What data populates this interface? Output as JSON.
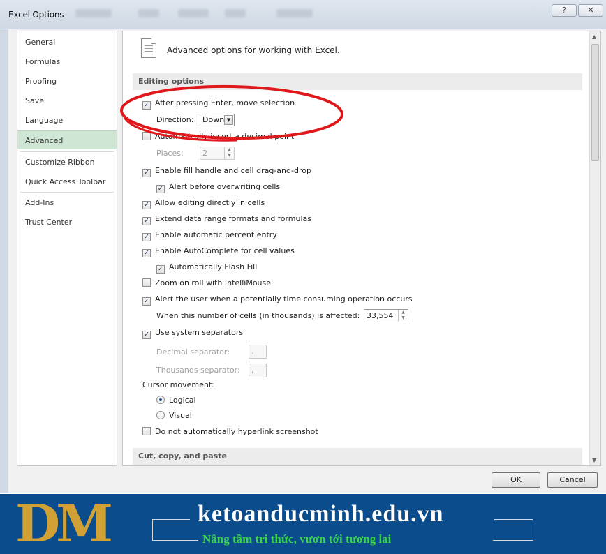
{
  "window": {
    "title": "Excel Options",
    "help_glyph": "?",
    "close_glyph": "✕"
  },
  "sidebar": {
    "items": [
      {
        "label": "General"
      },
      {
        "label": "Formulas"
      },
      {
        "label": "Proofing"
      },
      {
        "label": "Save"
      },
      {
        "label": "Language"
      },
      {
        "label": "Advanced",
        "selected": true
      },
      {
        "label": "Customize Ribbon"
      },
      {
        "label": "Quick Access Toolbar"
      },
      {
        "label": "Add-Ins"
      },
      {
        "label": "Trust Center"
      }
    ]
  },
  "main": {
    "header": "Advanced options for working with Excel.",
    "editing_section": "Editing options",
    "after_enter": {
      "label": "After pressing Enter, move selection",
      "checked": true
    },
    "direction": {
      "label": "Direction:",
      "value": "Down"
    },
    "decimal_point": {
      "label": "Automatically insert a decimal point",
      "checked": false
    },
    "places": {
      "label": "Places:",
      "value": "2"
    },
    "fill_handle": {
      "label": "Enable fill handle and cell drag-and-drop",
      "checked": true
    },
    "alert_overwrite": {
      "label": "Alert before overwriting cells",
      "checked": true
    },
    "edit_in_cells": {
      "label": "Allow editing directly in cells",
      "checked": true
    },
    "extend_range": {
      "label": "Extend data range formats and formulas",
      "checked": true
    },
    "auto_percent": {
      "label": "Enable automatic percent entry",
      "checked": true
    },
    "autocomplete": {
      "label": "Enable AutoComplete for cell values",
      "checked": true
    },
    "flash_fill": {
      "label": "Automatically Flash Fill",
      "checked": true
    },
    "zoom_roll": {
      "label": "Zoom on roll with IntelliMouse",
      "checked": false
    },
    "alert_time": {
      "label": "Alert the user when a potentially time consuming operation occurs",
      "checked": true
    },
    "cells_affected": {
      "label": "When this number of cells (in thousands) is affected:",
      "value": "33,554"
    },
    "system_separators": {
      "label": "Use system separators",
      "checked": true
    },
    "decimal_sep": {
      "label": "Decimal separator:",
      "value": "."
    },
    "thousands_sep": {
      "label": "Thousands separator:",
      "value": ","
    },
    "cursor_movement": {
      "label": "Cursor movement:",
      "options": [
        {
          "label": "Logical",
          "selected": true
        },
        {
          "label": "Visual",
          "selected": false
        }
      ]
    },
    "no_hyperlink": {
      "label": "Do not automatically hyperlink screenshot",
      "checked": false
    },
    "cut_section": "Cut, copy, and paste"
  },
  "footer": {
    "ok_label": "OK",
    "cancel_label": "Cancel"
  },
  "banner": {
    "logo_text": "DM",
    "site": "ketoanducminh.edu.vn",
    "slogan": "Nâng tầm tri thức, vươn tới tương lai"
  },
  "annotation_color": "#e0181b"
}
